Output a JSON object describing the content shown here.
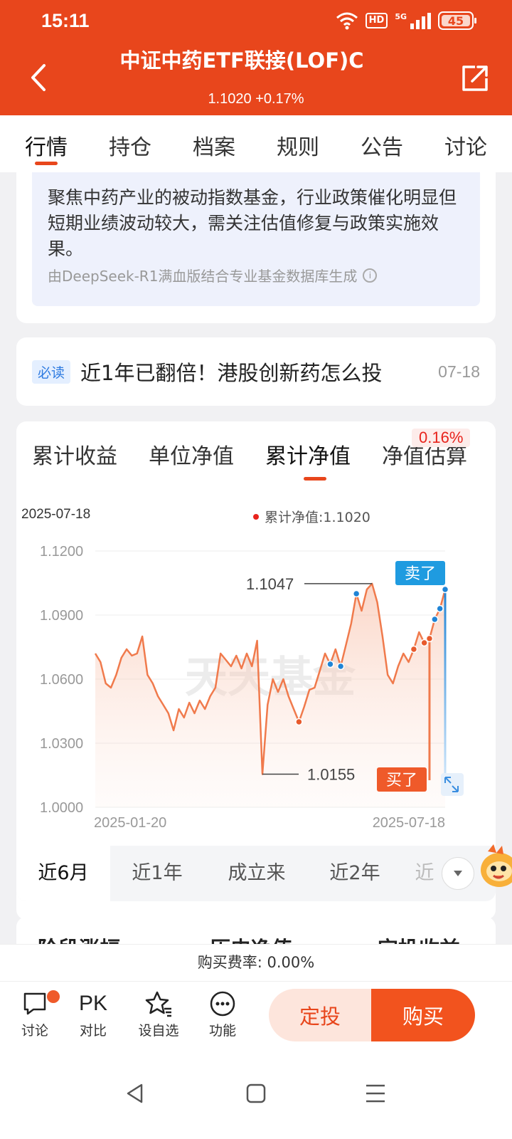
{
  "status_bar": {
    "time": "15:11",
    "hd": "HD",
    "network": "5G",
    "battery": "45"
  },
  "header": {
    "title": "中证中药ETF联接(LOF)C",
    "subtitle": "1.1020 +0.17%"
  },
  "tabs": [
    "行情",
    "持仓",
    "档案",
    "规则",
    "公告",
    "讨论"
  ],
  "ai_card": {
    "text": "聚焦中药产业的被动指数基金，行业政策催化明显但短期业绩波动较大，需关注估值修复与政策实施效果。",
    "footer": "由DeepSeek-R1满血版结合专业基金数据库生成"
  },
  "news": {
    "badge": "必读",
    "title": "近1年已翻倍！港股创新药怎么投",
    "date": "07-18"
  },
  "chart_tabs": [
    "累计收益",
    "单位净值",
    "累计净值",
    "净值估算"
  ],
  "estimate_badge": "0.16%",
  "chart_header": {
    "date": "2025-07-18",
    "legend": "累计净值:1.1020"
  },
  "chart_data": {
    "type": "line",
    "title": "",
    "xlabel": "",
    "ylabel": "",
    "x_range": [
      "2025-01-20",
      "2025-07-18"
    ],
    "x_tick_labels": [
      "2025-01-20",
      "2025-07-18"
    ],
    "ylim": [
      1.0,
      1.12
    ],
    "y_ticks": [
      "1.1200",
      "1.0900",
      "1.0600",
      "1.0300",
      "1.0000"
    ],
    "grid": true,
    "watermark": "天天基金",
    "series": [
      {
        "name": "累计净值",
        "color": "#f07a4c",
        "values": [
          1.072,
          1.068,
          1.058,
          1.056,
          1.062,
          1.07,
          1.074,
          1.071,
          1.072,
          1.08,
          1.062,
          1.058,
          1.052,
          1.048,
          1.044,
          1.036,
          1.046,
          1.042,
          1.049,
          1.044,
          1.05,
          1.046,
          1.052,
          1.056,
          1.072,
          1.069,
          1.066,
          1.071,
          1.065,
          1.072,
          1.066,
          1.078,
          1.0155,
          1.048,
          1.06,
          1.054,
          1.06,
          1.052,
          1.046,
          1.04,
          1.047,
          1.055,
          1.056,
          1.064,
          1.072,
          1.067,
          1.074,
          1.066,
          1.076,
          1.086,
          1.1,
          1.092,
          1.102,
          1.1047,
          1.096,
          1.08,
          1.062,
          1.058,
          1.066,
          1.072,
          1.068,
          1.074,
          1.082,
          1.077,
          1.079,
          1.088,
          1.093,
          1.102
        ]
      }
    ],
    "annotations": {
      "max": {
        "label": "1.1047",
        "value": 1.1047
      },
      "min": {
        "label": "1.0155",
        "value": 1.0155
      },
      "sell_label": "卖了",
      "buy_label": "买了"
    },
    "markers": [
      {
        "index": 39,
        "color": "#e85a2c"
      },
      {
        "index": 45,
        "color": "#1f84d6"
      },
      {
        "index": 47,
        "color": "#1f84d6"
      },
      {
        "index": 50,
        "color": "#1f84d6"
      },
      {
        "index": 61,
        "color": "#e85a2c"
      },
      {
        "index": 63,
        "color": "#e85a2c"
      },
      {
        "index": 64,
        "color": "#e85a2c"
      },
      {
        "index": 65,
        "color": "#1f84d6"
      },
      {
        "index": 66,
        "color": "#1f84d6"
      },
      {
        "index": 67,
        "color": "#1f84d6"
      }
    ]
  },
  "ranges": [
    "近6月",
    "近1年",
    "成立来",
    "近2年",
    "近"
  ],
  "stage_headers": [
    "阶段涨幅",
    "历史净值",
    "定投收益"
  ],
  "fee": "购买费率: 0.00%",
  "toolbar": {
    "items": [
      {
        "label": "讨论",
        "icon": "chat-icon"
      },
      {
        "label": "对比",
        "icon": "pk-icon",
        "text": "PK"
      },
      {
        "label": "设自选",
        "icon": "star-list-icon"
      },
      {
        "label": "功能",
        "icon": "more-circle-icon"
      }
    ],
    "dingtou": "定投",
    "buy": "购买"
  },
  "colors": {
    "brand": "#e8461c",
    "up": "#e8231c",
    "blue": "#1f84d6"
  }
}
